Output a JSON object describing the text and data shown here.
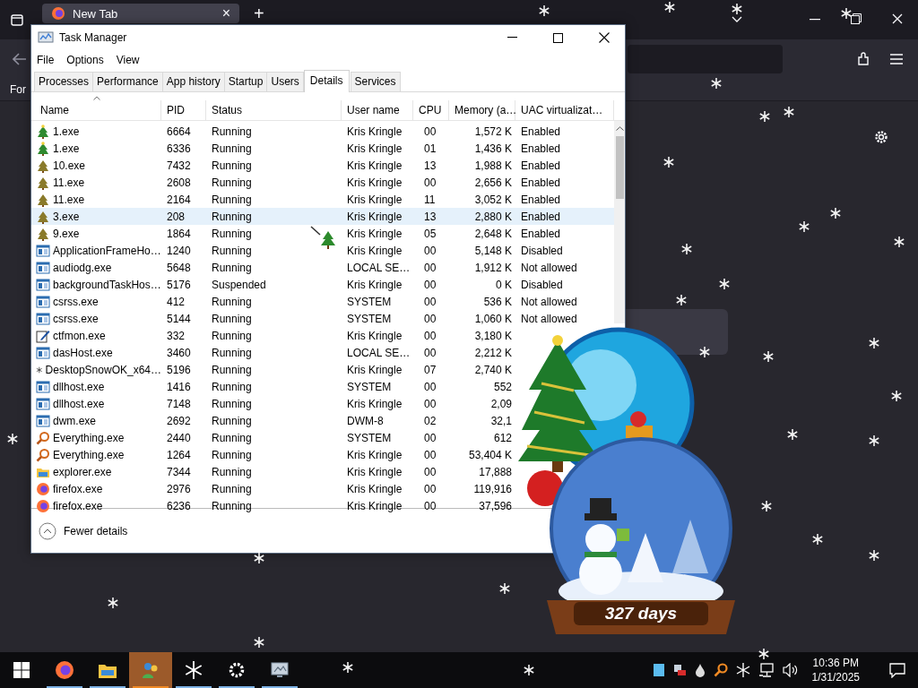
{
  "browser": {
    "tab": {
      "title": "New Tab",
      "close": "×"
    },
    "new_tab": "+",
    "page_text": "For"
  },
  "task_manager": {
    "title": "Task Manager",
    "menu": [
      "File",
      "Options",
      "View"
    ],
    "tabs": [
      {
        "label": "Processes",
        "selected": false
      },
      {
        "label": "Performance",
        "selected": false
      },
      {
        "label": "App history",
        "selected": false
      },
      {
        "label": "Startup",
        "selected": false
      },
      {
        "label": "Users",
        "selected": false
      },
      {
        "label": "Details",
        "selected": true
      },
      {
        "label": "Services",
        "selected": false
      }
    ],
    "columns": [
      "Name",
      "PID",
      "Status",
      "User name",
      "CPU",
      "Memory (a…",
      "UAC virtualizat…"
    ],
    "rows": [
      {
        "kind": "tree-star",
        "name": "1.exe",
        "pid": "6664",
        "status": "Running",
        "user": "Kris Kringle",
        "cpu": "00",
        "memory": "1,572 K",
        "uac": "Enabled",
        "selected": false
      },
      {
        "kind": "tree-star",
        "name": "1.exe",
        "pid": "6336",
        "status": "Running",
        "user": "Kris Kringle",
        "cpu": "01",
        "memory": "1,436 K",
        "uac": "Enabled",
        "selected": false
      },
      {
        "kind": "tree",
        "name": "10.exe",
        "pid": "7432",
        "status": "Running",
        "user": "Kris Kringle",
        "cpu": "13",
        "memory": "1,988 K",
        "uac": "Enabled",
        "selected": false
      },
      {
        "kind": "tree",
        "name": "11.exe",
        "pid": "2608",
        "status": "Running",
        "user": "Kris Kringle",
        "cpu": "00",
        "memory": "2,656 K",
        "uac": "Enabled",
        "selected": false
      },
      {
        "kind": "tree",
        "name": "11.exe",
        "pid": "2164",
        "status": "Running",
        "user": "Kris Kringle",
        "cpu": "11",
        "memory": "3,052 K",
        "uac": "Enabled",
        "selected": false
      },
      {
        "kind": "tree",
        "name": "3.exe",
        "pid": "208",
        "status": "Running",
        "user": "Kris Kringle",
        "cpu": "13",
        "memory": "2,880 K",
        "uac": "Enabled",
        "selected": true
      },
      {
        "kind": "tree",
        "name": "9.exe",
        "pid": "1864",
        "status": "Running",
        "user": "Kris Kringle",
        "cpu": "05",
        "memory": "2,648 K",
        "uac": "Enabled",
        "selected": false
      },
      {
        "kind": "app",
        "name": "ApplicationFrameHo…",
        "pid": "1240",
        "status": "Running",
        "user": "Kris Kringle",
        "cpu": "00",
        "memory": "5,148 K",
        "uac": "Disabled",
        "selected": false
      },
      {
        "kind": "app",
        "name": "audiodg.exe",
        "pid": "5648",
        "status": "Running",
        "user": "LOCAL SE…",
        "cpu": "00",
        "memory": "1,912 K",
        "uac": "Not allowed",
        "selected": false
      },
      {
        "kind": "app",
        "name": "backgroundTaskHos…",
        "pid": "5176",
        "status": "Suspended",
        "user": "Kris Kringle",
        "cpu": "00",
        "memory": "0 K",
        "uac": "Disabled",
        "selected": false
      },
      {
        "kind": "app",
        "name": "csrss.exe",
        "pid": "412",
        "status": "Running",
        "user": "SYSTEM",
        "cpu": "00",
        "memory": "536 K",
        "uac": "Not allowed",
        "selected": false
      },
      {
        "kind": "app",
        "name": "csrss.exe",
        "pid": "5144",
        "status": "Running",
        "user": "SYSTEM",
        "cpu": "00",
        "memory": "1,060 K",
        "uac": "Not allowed",
        "selected": false
      },
      {
        "kind": "pen",
        "name": "ctfmon.exe",
        "pid": "332",
        "status": "Running",
        "user": "Kris Kringle",
        "cpu": "00",
        "memory": "3,180 K",
        "selected": false
      },
      {
        "kind": "app",
        "name": "dasHost.exe",
        "pid": "3460",
        "status": "Running",
        "user": "LOCAL SE…",
        "cpu": "00",
        "memory": "2,212 K",
        "selected": false
      },
      {
        "kind": "snow",
        "name": "DesktopSnowOK_x64…",
        "pid": "5196",
        "status": "Running",
        "user": "Kris Kringle",
        "cpu": "07",
        "memory": "2,740 K",
        "selected": false
      },
      {
        "kind": "app",
        "name": "dllhost.exe",
        "pid": "1416",
        "status": "Running",
        "user": "SYSTEM",
        "cpu": "00",
        "memory": "552",
        "selected": false
      },
      {
        "kind": "app",
        "name": "dllhost.exe",
        "pid": "7148",
        "status": "Running",
        "user": "Kris Kringle",
        "cpu": "00",
        "memory": "2,09",
        "selected": false
      },
      {
        "kind": "app",
        "name": "dwm.exe",
        "pid": "2692",
        "status": "Running",
        "user": "DWM-8",
        "cpu": "02",
        "memory": "32,1",
        "selected": false
      },
      {
        "kind": "search",
        "name": "Everything.exe",
        "pid": "2440",
        "status": "Running",
        "user": "SYSTEM",
        "cpu": "00",
        "memory": "612",
        "selected": false
      },
      {
        "kind": "search",
        "name": "Everything.exe",
        "pid": "1264",
        "status": "Running",
        "user": "Kris Kringle",
        "cpu": "00",
        "memory": "53,404 K",
        "selected": false
      },
      {
        "kind": "folder",
        "name": "explorer.exe",
        "pid": "7344",
        "status": "Running",
        "user": "Kris Kringle",
        "cpu": "00",
        "memory": "17,888",
        "selected": false
      },
      {
        "kind": "firefox",
        "name": "firefox.exe",
        "pid": "2976",
        "status": "Running",
        "user": "Kris Kringle",
        "cpu": "00",
        "memory": "119,916",
        "selected": false
      },
      {
        "kind": "firefox",
        "name": "firefox.exe",
        "pid": "6236",
        "status": "Running",
        "user": "Kris Kringle",
        "cpu": "00",
        "memory": "37,596",
        "selected": false
      }
    ],
    "footer": "Fewer details"
  },
  "widget": {
    "countdown": "327 days"
  },
  "taskbar": {
    "apps": [
      {
        "kind": "firefox",
        "running": true,
        "active": false
      },
      {
        "kind": "folder",
        "running": true,
        "active": false
      },
      {
        "kind": "people",
        "running": true,
        "active": true
      },
      {
        "kind": "snow",
        "running": true,
        "active": false
      },
      {
        "kind": "gear",
        "running": true,
        "active": false
      },
      {
        "kind": "monitor",
        "running": true,
        "active": false
      }
    ],
    "time": "10:36 PM",
    "date": "1/31/2025"
  }
}
